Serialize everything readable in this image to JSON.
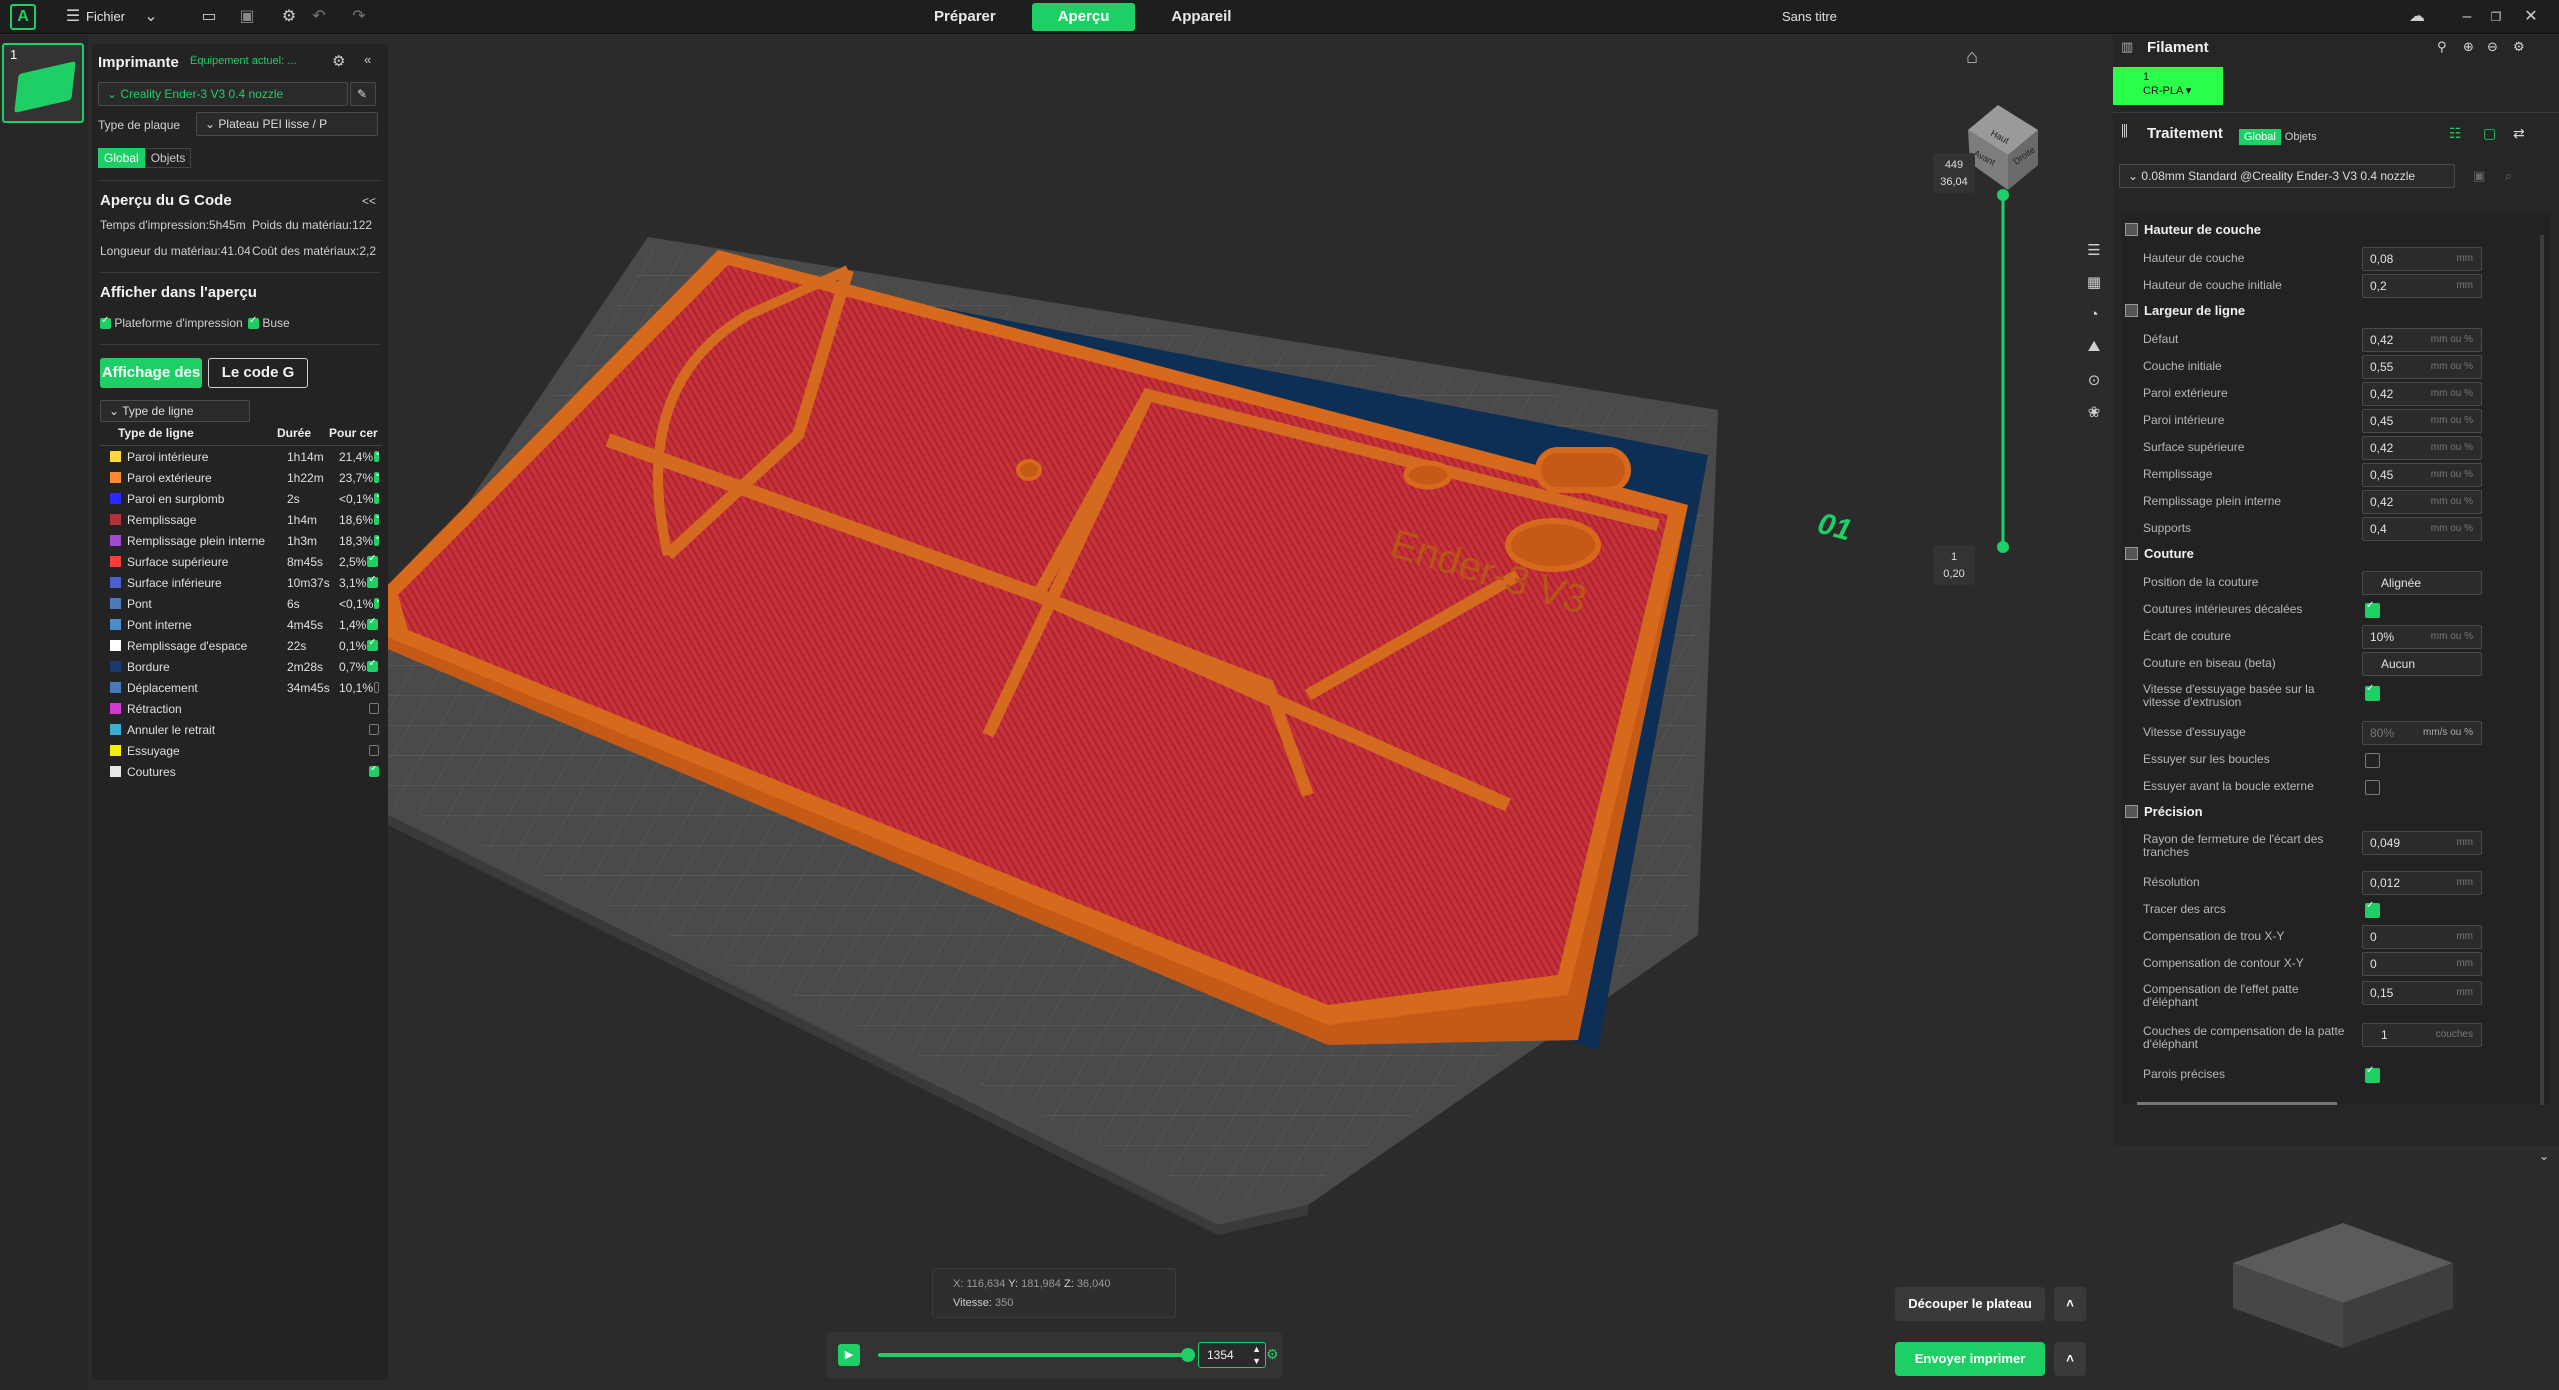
{
  "topbar": {
    "logo": "A",
    "file_menu": "Fichier",
    "tabs": [
      "Préparer",
      "Aperçu",
      "Appareil"
    ],
    "active_tab": "Aperçu",
    "project_title": "Sans titre"
  },
  "plate_thumb": {
    "number": "1"
  },
  "printer": {
    "title": "Imprimante",
    "current_equipment": "Équipement actuel: ...",
    "printer_name": "Creality Ender-3 V3 0.4 nozzle",
    "plate_type_label": "Type de plaque",
    "plate_type_value": "Plateau PEI lisse / P",
    "tab_global": "Global",
    "tab_objects": "Objets"
  },
  "gcode": {
    "title": "Aperçu du G Code",
    "collapse": "<<",
    "print_time": "Temps d'impression:5h45m",
    "material_weight": "Poids du matériau:122",
    "material_length": "Longueur du matériau:41.04m",
    "material_cost": "Coût des matériaux:2,2"
  },
  "display": {
    "title": "Afficher dans l'aperçu",
    "plate_checkbox": "Plateforme d'impression",
    "nozzle_checkbox": "Buse",
    "btn_display": "Affichage des",
    "btn_gcode": "Le code G",
    "line_type_select": "Type de ligne"
  },
  "legend": {
    "headers": [
      "Type de ligne",
      "Durée",
      "Pour cer"
    ],
    "rows": [
      {
        "name": "Paroi intérieure",
        "duration": "1h14m",
        "pct": "21,4%",
        "color": "#ffd83a",
        "checked": true
      },
      {
        "name": "Paroi extérieure",
        "duration": "1h22m",
        "pct": "23,7%",
        "color": "#ff8a33",
        "checked": true
      },
      {
        "name": "Paroi en surplomb",
        "duration": "2s",
        "pct": "<0,1%",
        "color": "#2a2aff",
        "checked": true
      },
      {
        "name": "Remplissage",
        "duration": "1h4m",
        "pct": "18,6%",
        "color": "#b5313a",
        "checked": true
      },
      {
        "name": "Remplissage plein interne",
        "duration": "1h3m",
        "pct": "18,3%",
        "color": "#a04ad0",
        "checked": true
      },
      {
        "name": "Surface supérieure",
        "duration": "8m45s",
        "pct": "2,5%",
        "color": "#ff3a3a",
        "checked": true
      },
      {
        "name": "Surface inférieure",
        "duration": "10m37s",
        "pct": "3,1%",
        "color": "#4b5fd0",
        "checked": true
      },
      {
        "name": "Pont",
        "duration": "6s",
        "pct": "<0,1%",
        "color": "#4f7ab8",
        "checked": true
      },
      {
        "name": "Pont interne",
        "duration": "4m45s",
        "pct": "1,4%",
        "color": "#4d8cc9",
        "checked": true
      },
      {
        "name": "Remplissage d'espace",
        "duration": "22s",
        "pct": "0,1%",
        "color": "#ffffff",
        "checked": true
      },
      {
        "name": "Bordure",
        "duration": "2m28s",
        "pct": "0,7%",
        "color": "#1a3a6e",
        "checked": true
      },
      {
        "name": "Déplacement",
        "duration": "34m45s",
        "pct": "10,1%",
        "color": "#4a78b8",
        "checked": false
      },
      {
        "name": "Rétraction",
        "duration": "",
        "pct": "",
        "color": "#d03ad0",
        "checked": false
      },
      {
        "name": "Annuler le retrait",
        "duration": "",
        "pct": "",
        "color": "#3ab0d0",
        "checked": false
      },
      {
        "name": "Essuyage",
        "duration": "",
        "pct": "",
        "color": "#f0f000",
        "checked": false
      },
      {
        "name": "Coutures",
        "duration": "",
        "pct": "",
        "color": "#e8e8e8",
        "checked": true
      }
    ]
  },
  "viewport": {
    "layer_top": "449",
    "layer_top_height": "36,04",
    "layer_bottom": "1",
    "layer_bottom_height": "0,20",
    "plate_number_label": "01",
    "embossed_text": "Ender-3 V3",
    "cube_labels": [
      "Haut",
      "Avant",
      "Droite"
    ],
    "coord_x_label": "X:",
    "coord_x": "116,634",
    "coord_y_label": "Y:",
    "coord_y": "181,984",
    "coord_z_label": "Z:",
    "coord_z": "36,040",
    "speed_label": "Vitesse:",
    "speed": "350",
    "move_index": "1354",
    "move_progress": 1.0
  },
  "actions": {
    "slice": "Découper le plateau",
    "send": "Envoyer imprimer"
  },
  "filament": {
    "title": "Filament",
    "slot_number": "1",
    "slot_material": "CR-PLA"
  },
  "process": {
    "title": "Traitement",
    "tab_global": "Global",
    "tab_objects": "Objets",
    "preset": "0.08mm Standard @Creality Ender-3 V3 0.4 nozzle",
    "groups": {
      "layer_height": "Hauteur de couche",
      "line_width": "Largeur de ligne",
      "seam": "Couture",
      "precision": "Précision"
    },
    "params": {
      "layer_height": {
        "label": "Hauteur de couche",
        "value": "0,08",
        "unit": "mm"
      },
      "initial_layer_height": {
        "label": "Hauteur de couche initiale",
        "value": "0,2",
        "unit": "mm"
      },
      "lw_default": {
        "label": "Défaut",
        "value": "0,42",
        "unit": "mm ou %"
      },
      "lw_initial": {
        "label": "Couche initiale",
        "value": "0,55",
        "unit": "mm ou %"
      },
      "lw_outer": {
        "label": "Paroi extérieure",
        "value": "0,42",
        "unit": "mm ou %"
      },
      "lw_inner": {
        "label": "Paroi intérieure",
        "value": "0,45",
        "unit": "mm ou %"
      },
      "lw_top": {
        "label": "Surface supérieure",
        "value": "0,42",
        "unit": "mm ou %"
      },
      "lw_infill": {
        "label": "Remplissage",
        "value": "0,45",
        "unit": "mm ou %"
      },
      "lw_solid": {
        "label": "Remplissage plein interne",
        "value": "0,42",
        "unit": "mm ou %"
      },
      "lw_support": {
        "label": "Supports",
        "value": "0,4",
        "unit": "mm ou %"
      },
      "seam_position": {
        "label": "Position de la couture",
        "value": "Alignée"
      },
      "staggered": {
        "label": "Coutures intérieures décalées"
      },
      "seam_gap": {
        "label": "Écart de couture",
        "value": "10%",
        "unit": "mm ou %"
      },
      "scarf_seam": {
        "label": "Couture en biseau (beta)",
        "value": "Aucun"
      },
      "wipe_speed_based": {
        "label": "Vitesse d'essuyage basée sur la vitesse d'extrusion"
      },
      "wipe_speed": {
        "label": "Vitesse d'essuyage",
        "value": "80%",
        "unit": "mm/s ou %"
      },
      "wipe_on_loops": {
        "label": "Essuyer sur les boucles"
      },
      "wipe_before_outer": {
        "label": "Essuyer avant la boucle externe"
      },
      "slice_closing_radius": {
        "label": "Rayon de fermeture de l'écart des tranches",
        "value": "0,049",
        "unit": "mm"
      },
      "resolution": {
        "label": "Résolution",
        "value": "0,012",
        "unit": "mm"
      },
      "arc_fitting": {
        "label": "Tracer des arcs"
      },
      "xy_hole_comp": {
        "label": "Compensation de trou X-Y",
        "value": "0",
        "unit": "mm"
      },
      "xy_contour_comp": {
        "label": "Compensation de contour X-Y",
        "value": "0",
        "unit": "mm"
      },
      "elephant_foot": {
        "label": "Compensation de l'effet patte d'éléphant",
        "value": "0,15",
        "unit": "mm"
      },
      "elephant_layers": {
        "label": "Couches de compensation de la patte d'éléphant",
        "value": "1",
        "unit": "couches"
      },
      "precise_wall": {
        "label": "Parois précises"
      }
    }
  }
}
